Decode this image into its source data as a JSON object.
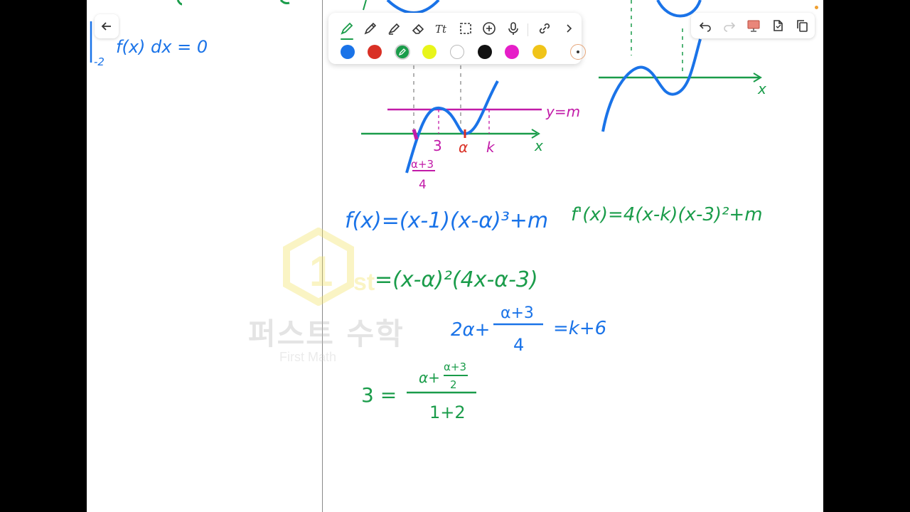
{
  "toolbar": {
    "tools": [
      {
        "name": "highlighter-pen",
        "icon": "pen-icon",
        "active": true
      },
      {
        "name": "pencil",
        "icon": "pencil-icon"
      },
      {
        "name": "highlighter",
        "icon": "highlighter-icon"
      },
      {
        "name": "eraser",
        "icon": "eraser-icon"
      },
      {
        "name": "text",
        "icon": "text-icon"
      },
      {
        "name": "lasso",
        "icon": "lasso-icon"
      },
      {
        "name": "add",
        "icon": "plus-circle-icon"
      },
      {
        "name": "microphone",
        "icon": "mic-icon"
      },
      {
        "name": "link",
        "icon": "link-icon"
      },
      {
        "name": "more",
        "icon": "chevron-right-icon"
      }
    ],
    "colors": [
      "#1a73e8",
      "#d93025",
      "#1a9c4a",
      "#e8f51a",
      "#ffffff",
      "#111111",
      "#e61ec8",
      "#f0c419"
    ],
    "selected_color": "#1a9c4a"
  },
  "right_tools": [
    "undo-icon",
    "redo-icon",
    "present-icon",
    "pages-icon",
    "copy-icon"
  ],
  "watermark": {
    "logo_text": "st",
    "korean": "퍼스트 수학",
    "english": "First Math"
  },
  "notes": {
    "top_left": "f(x) dx = 0",
    "lower_limit": "-2",
    "graph_labels": {
      "line": "y=m",
      "x1": "3",
      "x2": "α",
      "x3": "k",
      "x_axis": "x",
      "root": "α+3",
      "root_den": "4"
    },
    "right_axis": "x",
    "eq1": "f(x)=(x-1)(x-α)³+m",
    "eq2": "f'(x)=4(x-k)(x-3)²+m",
    "eq3": "=(x-α)²(4x-α-3)",
    "eq4_left": "2α+",
    "eq4_num": "α+3",
    "eq4_den": "4",
    "eq4_right": "=k+6",
    "eq5_left": "3 =",
    "eq5_num_a": "α+",
    "eq5_num_frac_top": "α+3",
    "eq5_num_frac_bot": "2",
    "eq5_den": "1+2"
  }
}
